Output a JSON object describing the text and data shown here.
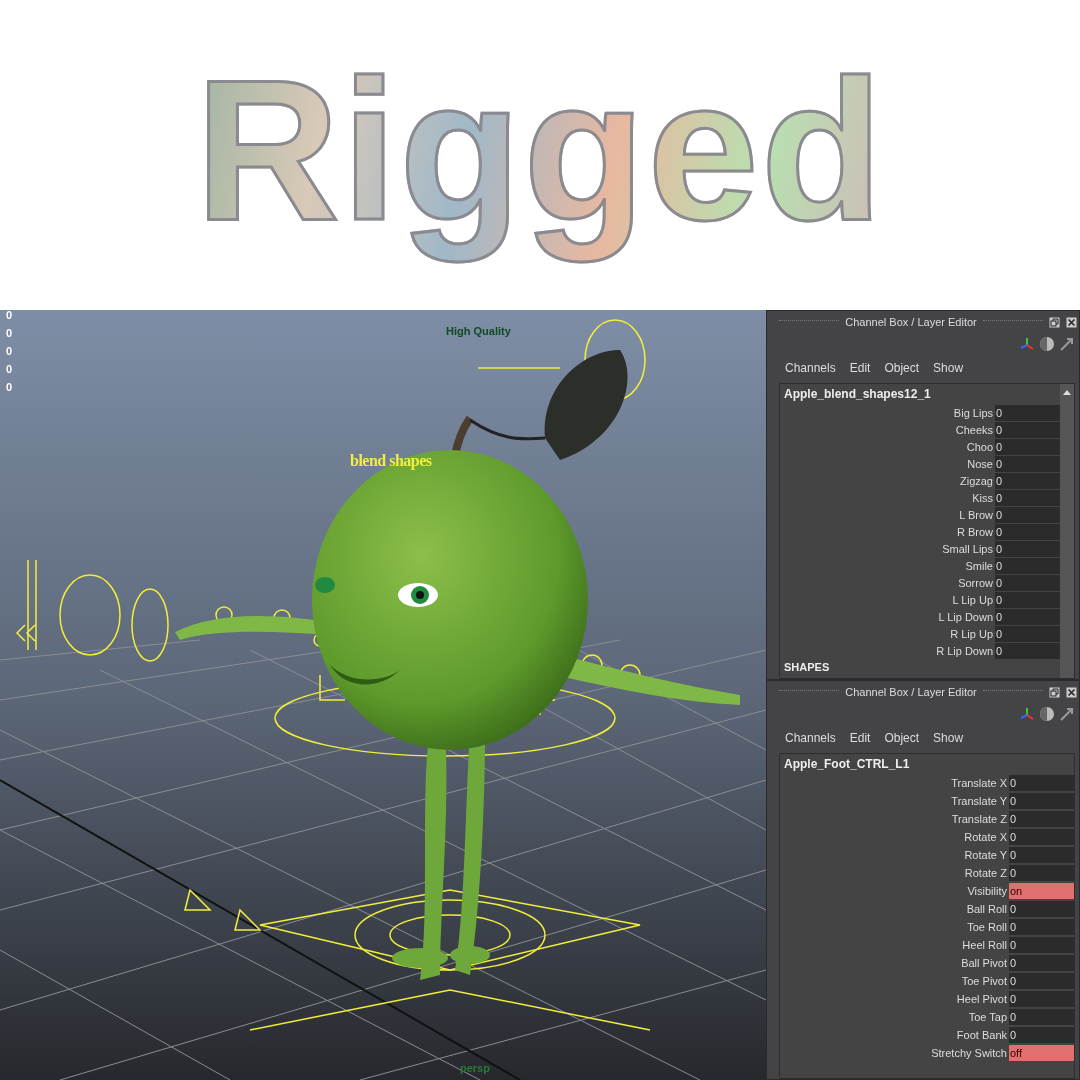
{
  "title": "Rigged",
  "viewport": {
    "hud_values": [
      "0",
      "0",
      "0",
      "0",
      "0"
    ],
    "quality_label": "High Quality",
    "annotation": "blend shapes",
    "camera": "persp"
  },
  "panels": [
    {
      "title": "Channel Box / Layer Editor",
      "menu": [
        "Channels",
        "Edit",
        "Object",
        "Show"
      ],
      "node": "Apple_blend_shapes12_1",
      "section": "SHAPES",
      "channels": [
        {
          "name": "Big Lips",
          "value": "0",
          "kind": "number"
        },
        {
          "name": "Cheeks",
          "value": "0",
          "kind": "number"
        },
        {
          "name": "Choo",
          "value": "0",
          "kind": "number"
        },
        {
          "name": "Nose",
          "value": "0",
          "kind": "number"
        },
        {
          "name": "Zigzag",
          "value": "0",
          "kind": "number"
        },
        {
          "name": "Kiss",
          "value": "0",
          "kind": "number"
        },
        {
          "name": "L Brow",
          "value": "0",
          "kind": "number"
        },
        {
          "name": "R Brow",
          "value": "0",
          "kind": "number"
        },
        {
          "name": "Small Lips",
          "value": "0",
          "kind": "number"
        },
        {
          "name": "Smile",
          "value": "0",
          "kind": "number"
        },
        {
          "name": "Sorrow",
          "value": "0",
          "kind": "number"
        },
        {
          "name": "L Lip Up",
          "value": "0",
          "kind": "number"
        },
        {
          "name": "L Lip Down",
          "value": "0",
          "kind": "number"
        },
        {
          "name": "R Lip Up",
          "value": "0",
          "kind": "number"
        },
        {
          "name": "R Lip Down",
          "value": "0",
          "kind": "number"
        }
      ]
    },
    {
      "title": "Channel Box / Layer Editor",
      "menu": [
        "Channels",
        "Edit",
        "Object",
        "Show"
      ],
      "node": "Apple_Foot_CTRL_L1",
      "channels": [
        {
          "name": "Translate X",
          "value": "0",
          "kind": "number"
        },
        {
          "name": "Translate Y",
          "value": "0",
          "kind": "number"
        },
        {
          "name": "Translate Z",
          "value": "0",
          "kind": "number"
        },
        {
          "name": "Rotate X",
          "value": "0",
          "kind": "number"
        },
        {
          "name": "Rotate Y",
          "value": "0",
          "kind": "number"
        },
        {
          "name": "Rotate Z",
          "value": "0",
          "kind": "number"
        },
        {
          "name": "Visibility",
          "value": "on",
          "kind": "toggle"
        },
        {
          "name": "Ball Roll",
          "value": "0",
          "kind": "number"
        },
        {
          "name": "Toe Roll",
          "value": "0",
          "kind": "number"
        },
        {
          "name": "Heel Roll",
          "value": "0",
          "kind": "number"
        },
        {
          "name": "Ball Pivot",
          "value": "0",
          "kind": "number"
        },
        {
          "name": "Toe Pivot",
          "value": "0",
          "kind": "number"
        },
        {
          "name": "Heel Pivot",
          "value": "0",
          "kind": "number"
        },
        {
          "name": "Toe Tap",
          "value": "0",
          "kind": "number"
        },
        {
          "name": "Foot Bank",
          "value": "0",
          "kind": "number"
        },
        {
          "name": "Stretchy Switch",
          "value": "off",
          "kind": "toggle"
        }
      ]
    }
  ]
}
